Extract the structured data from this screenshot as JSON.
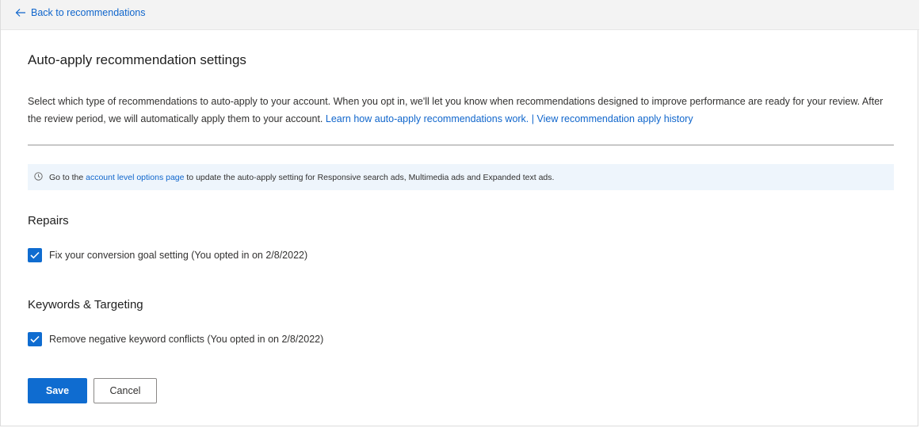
{
  "nav": {
    "back_label": "Back to recommendations",
    "back_icon": "arrow-left-icon"
  },
  "page": {
    "title": "Auto-apply recommendation settings",
    "description_text": "Select which type of recommendations to auto-apply to your account. When you opt in, we'll let you know when recommendations designed to improve performance are ready for your review. After the review period, we will automatically apply them to your account.",
    "learn_link": "Learn how auto-apply recommendations work.",
    "separator": "|",
    "history_link": "View recommendation apply history"
  },
  "info_banner": {
    "icon": "clock-icon",
    "prefix": "Go to the",
    "link": "account level options page",
    "suffix": "to update the auto-apply setting for Responsive search ads, Multimedia ads and Expanded text ads."
  },
  "sections": [
    {
      "heading": "Repairs",
      "options": [
        {
          "label": "Fix your conversion goal setting (You opted in on 2/8/2022)",
          "checked": true
        }
      ]
    },
    {
      "heading": "Keywords & Targeting",
      "options": [
        {
          "label": "Remove negative keyword conflicts (You opted in on 2/8/2022)",
          "checked": true
        }
      ]
    }
  ],
  "actions": {
    "save_label": "Save",
    "cancel_label": "Cancel"
  },
  "colors": {
    "accent": "#0f6cd0",
    "link": "#1066cc",
    "info_bg": "#eef5fc",
    "topbar_bg": "#f3f3f3"
  }
}
